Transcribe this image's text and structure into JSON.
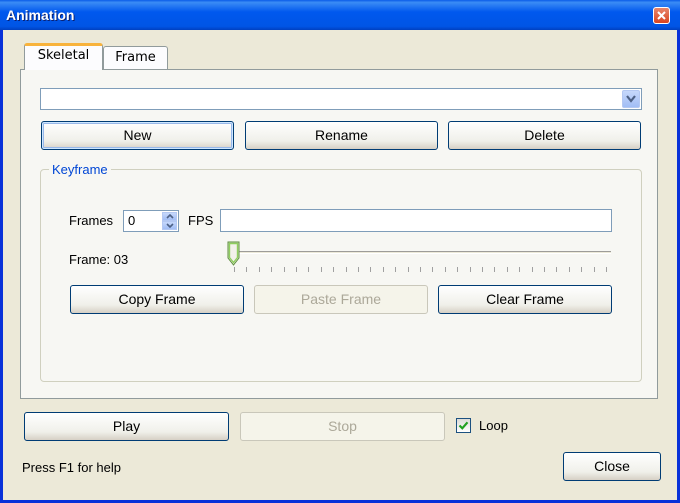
{
  "window": {
    "title": "Animation"
  },
  "tabs": [
    {
      "label": "Skeletal",
      "active": true
    },
    {
      "label": "Frame",
      "active": false
    }
  ],
  "animation_select": {
    "value": ""
  },
  "buttons": {
    "new": "New",
    "rename": "Rename",
    "delete": "Delete"
  },
  "keyframe": {
    "legend": "Keyframe",
    "frames_label": "Frames",
    "frames_value": "0",
    "fps_label": "FPS",
    "fps_value": "",
    "frame_label": "Frame: 03",
    "slider_fraction": 0,
    "copy": "Copy Frame",
    "paste": "Paste Frame",
    "clear": "Clear Frame"
  },
  "playback": {
    "play": "Play",
    "stop": "Stop",
    "loop_label": "Loop",
    "loop_checked": true
  },
  "footer": {
    "help": "Press F1 for help",
    "close": "Close"
  },
  "icons": [
    "close-icon",
    "chevron-down-icon",
    "spin-up-icon",
    "spin-down-icon",
    "slider-thumb-icon",
    "checkmark-icon"
  ]
}
